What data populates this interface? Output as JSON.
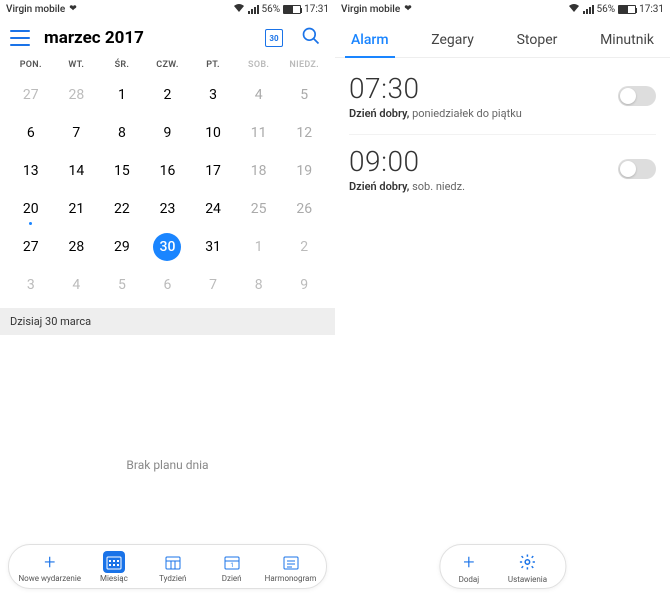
{
  "statusbar": {
    "carrier": "Virgin mobile",
    "battery": "56%",
    "time": "17:31"
  },
  "calendar": {
    "title": "marzec 2017",
    "today_icon_day": "30",
    "day_headers": [
      "PON.",
      "WT.",
      "ŚR.",
      "CZW.",
      "PT.",
      "SOB.",
      "NIEDZ."
    ],
    "cells": [
      {
        "n": "27",
        "cls": "other"
      },
      {
        "n": "28",
        "cls": "other"
      },
      {
        "n": "1"
      },
      {
        "n": "2"
      },
      {
        "n": "3"
      },
      {
        "n": "4",
        "cls": "wknd"
      },
      {
        "n": "5",
        "cls": "wknd"
      },
      {
        "n": "6"
      },
      {
        "n": "7"
      },
      {
        "n": "8"
      },
      {
        "n": "9"
      },
      {
        "n": "10"
      },
      {
        "n": "11",
        "cls": "wknd"
      },
      {
        "n": "12",
        "cls": "wknd"
      },
      {
        "n": "13"
      },
      {
        "n": "14"
      },
      {
        "n": "15"
      },
      {
        "n": "16"
      },
      {
        "n": "17"
      },
      {
        "n": "18",
        "cls": "wknd"
      },
      {
        "n": "19",
        "cls": "wknd"
      },
      {
        "n": "20",
        "dot": true
      },
      {
        "n": "21"
      },
      {
        "n": "22"
      },
      {
        "n": "23"
      },
      {
        "n": "24"
      },
      {
        "n": "25",
        "cls": "wknd"
      },
      {
        "n": "26",
        "cls": "wknd"
      },
      {
        "n": "27"
      },
      {
        "n": "28"
      },
      {
        "n": "29"
      },
      {
        "n": "30",
        "selected": true
      },
      {
        "n": "31"
      },
      {
        "n": "1",
        "cls": "other"
      },
      {
        "n": "2",
        "cls": "other"
      },
      {
        "n": "3",
        "cls": "other"
      },
      {
        "n": "4",
        "cls": "other"
      },
      {
        "n": "5",
        "cls": "other"
      },
      {
        "n": "6",
        "cls": "other"
      },
      {
        "n": "7",
        "cls": "other"
      },
      {
        "n": "8",
        "cls": "other"
      },
      {
        "n": "9",
        "cls": "other"
      }
    ],
    "today_label": "Dzisiaj  30 marca",
    "empty_text": "Brak planu dnia",
    "bottom": [
      {
        "label": "Nowe wydarzenie",
        "icon": "plus"
      },
      {
        "label": "Miesiąc",
        "icon": "month",
        "active": true
      },
      {
        "label": "Tydzień",
        "icon": "week"
      },
      {
        "label": "Dzień",
        "icon": "day"
      },
      {
        "label": "Harmonogram",
        "icon": "agenda"
      }
    ]
  },
  "clock": {
    "tabs": [
      {
        "label": "Alarm",
        "active": true
      },
      {
        "label": "Zegary"
      },
      {
        "label": "Stoper"
      },
      {
        "label": "Minutnik"
      }
    ],
    "alarms": [
      {
        "time": "07:30",
        "name": "Dzień dobry,",
        "days": " poniedziałek do piątku"
      },
      {
        "time": "09:00",
        "name": "Dzień dobry,",
        "days": " sob. niedz."
      }
    ],
    "bottom": {
      "add": "Dodaj",
      "settings": "Ustawienia"
    }
  }
}
